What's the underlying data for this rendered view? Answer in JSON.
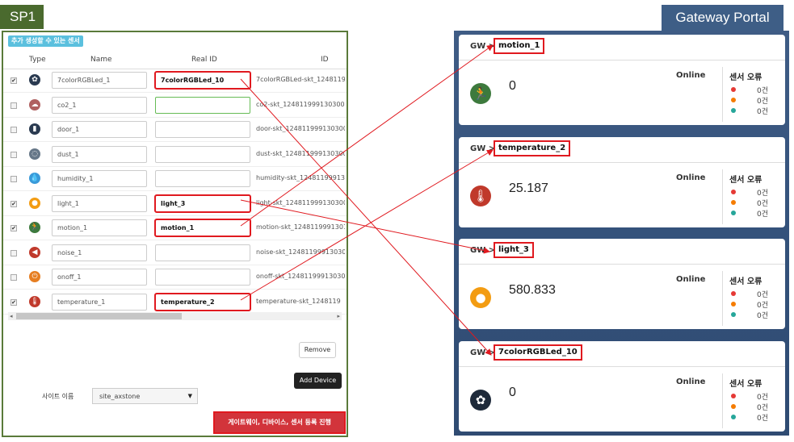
{
  "left": {
    "tab_title": "SP1",
    "badge": "추가 생성할 수 있는 센서",
    "columns": [
      "Type",
      "Name",
      "Real ID",
      "ID"
    ],
    "rows": [
      {
        "checked": true,
        "icon": "rgb-led-icon",
        "icon_color": "#2a3a50",
        "glyph": "✿",
        "name": "7colorRGBLed_1",
        "real_id": "7colorRGBLed_10",
        "id": "7colorRGBLed-skt_1248119",
        "highlight": true
      },
      {
        "checked": false,
        "icon": "co2-icon",
        "icon_color": "#b06060",
        "glyph": "☁",
        "name": "co2_1",
        "real_id": "",
        "id": "co2-skt_124811999130300",
        "focus": true
      },
      {
        "checked": false,
        "icon": "door-icon",
        "icon_color": "#2a3a50",
        "glyph": "▮",
        "name": "door_1",
        "real_id": "",
        "id": "door-skt_124811999130300"
      },
      {
        "checked": false,
        "icon": "dust-icon",
        "icon_color": "#667788",
        "glyph": "◌",
        "name": "dust_1",
        "real_id": "",
        "id": "dust-skt_124811999130300"
      },
      {
        "checked": false,
        "icon": "humidity-icon",
        "icon_color": "#3a9ad9",
        "glyph": "💧",
        "name": "humidity_1",
        "real_id": "",
        "id": "humidity-skt_1248119991310"
      },
      {
        "checked": true,
        "icon": "light-icon",
        "icon_color": "#f39c12",
        "glyph": "●",
        "name": "light_1",
        "real_id": "light_3",
        "id": "light-skt_124811999130300",
        "highlight": true
      },
      {
        "checked": true,
        "icon": "motion-icon",
        "icon_color": "#3d7a3d",
        "glyph": "🏃",
        "name": "motion_1",
        "real_id": "motion_1",
        "id": "motion-skt_1248119991301",
        "highlight": true
      },
      {
        "checked": false,
        "icon": "noise-icon",
        "icon_color": "#c0392b",
        "glyph": "◀",
        "name": "noise_1",
        "real_id": "",
        "id": "noise-skt_12481199913030"
      },
      {
        "checked": false,
        "icon": "onoff-icon",
        "icon_color": "#e67e22",
        "glyph": "⏻",
        "name": "onoff_1",
        "real_id": "",
        "id": "onoff-skt_124811999130300"
      },
      {
        "checked": true,
        "icon": "thermometer-icon",
        "icon_color": "#c0392b",
        "glyph": "🌡",
        "name": "temperature_1",
        "real_id": "temperature_2",
        "id": "temperature-skt_1248119",
        "highlight": true
      }
    ],
    "remove_label": "Remove",
    "add_label": "Add Device",
    "site_label": "사이트 이름",
    "site_value": "site_axstone",
    "register_label": "게이트웨이, 디바이스, 센서 등록 진행"
  },
  "right": {
    "title": "Gateway Portal",
    "cards": [
      {
        "gw": "GW >",
        "name": "motion_1",
        "status": "Online",
        "value": "0",
        "icon": "motion-icon",
        "icon_color": "#3d7a3d",
        "glyph": "🏃"
      },
      {
        "gw": "GW >",
        "name": "temperature_2",
        "status": "Online",
        "value": "25.187",
        "icon": "thermometer-icon",
        "icon_color": "#c0392b",
        "glyph": "🌡"
      },
      {
        "gw": "GW >",
        "name": "light_3",
        "status": "Online",
        "value": "580.833",
        "icon": "light-icon",
        "icon_color": "#f39c12",
        "glyph": "●"
      },
      {
        "gw": "GW >",
        "name": "7colorRGBLed_10",
        "status": "Online",
        "value": "0",
        "icon": "rgb-led-icon",
        "icon_color": "#1e2a3a",
        "glyph": "✿"
      }
    ],
    "error_title": "센서 오류",
    "error_rows": [
      {
        "color": "#e53935",
        "count": "0건"
      },
      {
        "color": "#f57c00",
        "count": "0건"
      },
      {
        "color": "#26a69a",
        "count": "0건"
      }
    ]
  },
  "colors": {
    "highlight": "#e0191f",
    "sp1": "#4a6a2e",
    "portal": "#3e5e86"
  }
}
